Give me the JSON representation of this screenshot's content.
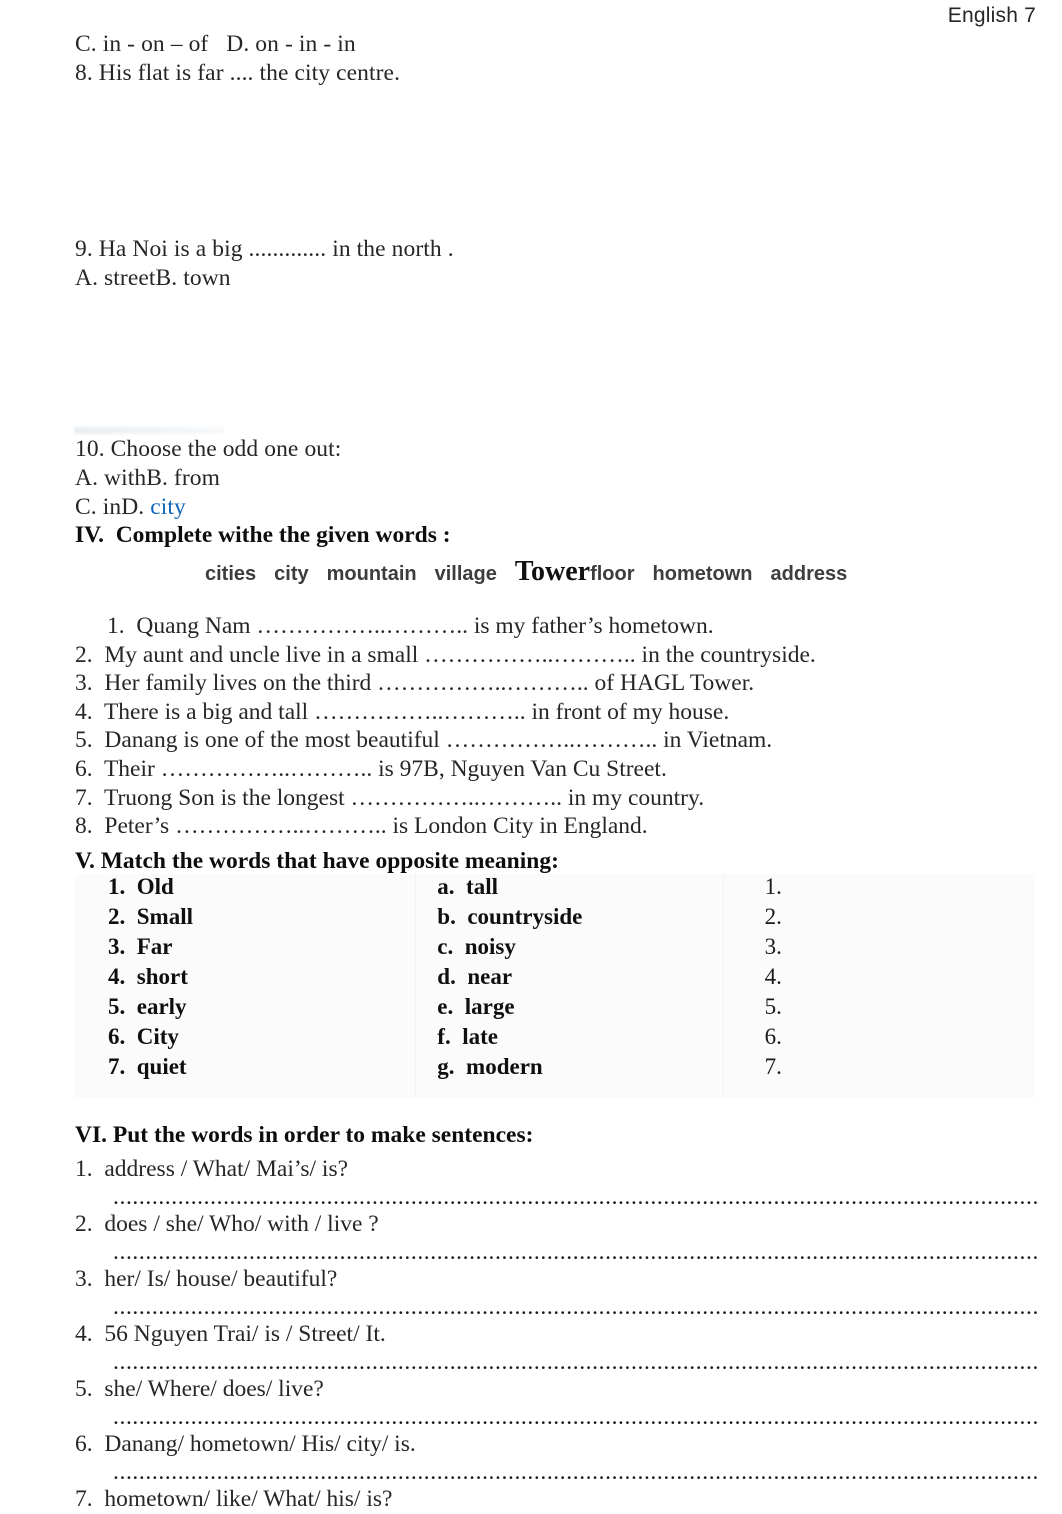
{
  "header": {
    "title": "English 7"
  },
  "top_questions": [
    {
      "id": "q7-options",
      "text": "C. in - on – of   D. on - in - in"
    },
    {
      "id": "q8",
      "text": "8. His flat is far .... the city centre."
    }
  ],
  "mid_questions": [
    {
      "id": "q9",
      "text": "9. Ha Noi is a big ............. in the north ."
    },
    {
      "id": "q9-options",
      "text": "A. streetB. town"
    }
  ],
  "q10": {
    "prompt": "10. Choose the odd one out:",
    "option_ab": "A. withB. from",
    "option_cd_prefix": "C. inD. ",
    "option_cd_answer": "city",
    "answer_color": "#1066b8"
  },
  "section_iv": {
    "heading": "IV.  Complete withe the given words :",
    "word_bank": [
      {
        "word": "cities",
        "style": "sans"
      },
      {
        "word": "city",
        "style": "sans"
      },
      {
        "word": "mountain",
        "style": "sans"
      },
      {
        "word": "village",
        "style": "sans"
      },
      {
        "word": "Tower",
        "style": "serif-large"
      },
      {
        "word": "floor",
        "style": "sans"
      },
      {
        "word": "hometown",
        "style": "sans"
      },
      {
        "word": "address",
        "style": "sans"
      }
    ],
    "items": [
      "1.  Quang Nam ……………..……….. is my father’s hometown.",
      "2.  My aunt and uncle live in a small ……………..……….. in the countryside.",
      "3.  Her family lives on the third ……………..……….. of HAGL Tower.",
      "4.  There is a big and tall ……………..……….. in front of my house.",
      "5.  Danang is one of the most beautiful ……………..……….. in Vietnam.",
      "6.  Their ……………..……….. is 97B, Nguyen Van Cu Street.",
      "7.  Truong Son is the longest ……………..……….. in my country.",
      "8.  Peter’s ……………..……….. is London City in England."
    ]
  },
  "section_v": {
    "heading": "V. Match the words that have opposite meaning:",
    "rows": [
      {
        "left": "1.  Old",
        "middle": "a.  tall",
        "right": "1."
      },
      {
        "left": "2.  Small",
        "middle": "b.  countryside",
        "right": "2."
      },
      {
        "left": "3.  Far",
        "middle": "c.  noisy",
        "right": "3."
      },
      {
        "left": "4.  short",
        "middle": "d.  near",
        "right": "4."
      },
      {
        "left": "5.  early",
        "middle": "e.  large",
        "right": "5."
      },
      {
        "left": "6.  City",
        "middle": "f.  late",
        "right": "6."
      },
      {
        "left": "7.  quiet",
        "middle": "g.  modern",
        "right": "7."
      }
    ]
  },
  "section_vi": {
    "heading": "VI. Put the words in order to make sentences:",
    "answer_dots": "....................................................................................................................................................................................",
    "items": [
      "1.  address / What/ Mai’s/ is?",
      "2.  does / she/ Who/ with / live ?",
      "3.  her/ Is/ house/ beautiful?",
      "4.  56 Nguyen Trai/ is / Street/ It.",
      "5.  she/ Where/ does/ live?",
      "6.  Danang/ hometown/ His/ city/ is.",
      "7.  hometown/ like/ What/ his/ is?"
    ]
  }
}
